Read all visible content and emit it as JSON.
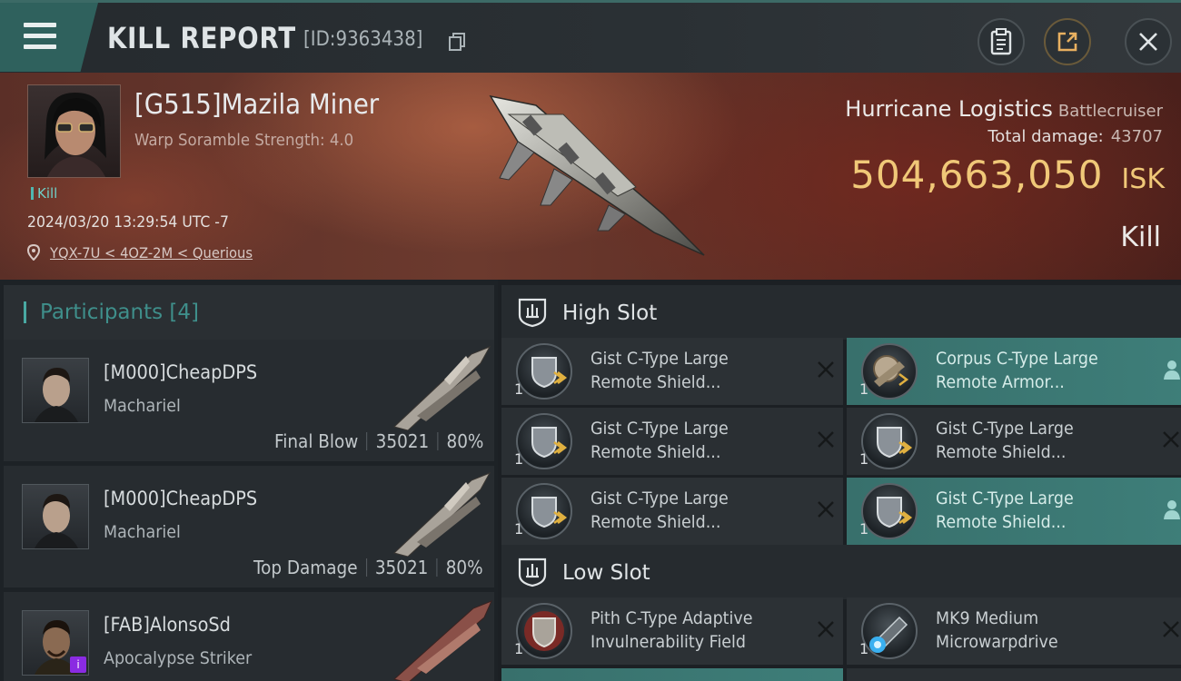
{
  "title": {
    "heading": "KILL REPORT",
    "id_text": "[ID:9363438]"
  },
  "victim": {
    "name": "[G515]Mazila Miner",
    "subtitle": "Warp Soramble Strength: 4.0",
    "tag": "Kill",
    "datetime": "2024/03/20 13:29:54 UTC -7",
    "location": "YQX-7U < 4OZ-2M < Querious",
    "ship_name": "Hurricane Logistics",
    "ship_class": "Battlecruiser",
    "total_damage_label": "Total damage:",
    "total_damage_value": "43707",
    "isk_value": "504,663,050",
    "isk_unit": "ISK",
    "result_label": "Kill"
  },
  "participants": {
    "header": "Participants [4]",
    "rows": [
      {
        "name": "[M000]CheapDPS",
        "ship": "Machariel",
        "role": "Final Blow",
        "damage": "35021",
        "percent": "80%"
      },
      {
        "name": "[M000]CheapDPS",
        "ship": "Machariel",
        "role": "Top Damage",
        "damage": "35021",
        "percent": "80%"
      },
      {
        "name": "[FAB]AlonsoSd",
        "ship": "Apocalypse Striker",
        "badge": "i"
      }
    ]
  },
  "fitting": {
    "high_slot_label": "High Slot",
    "low_slot_label": "Low Slot",
    "high_modules": [
      {
        "line1": "Gist C-Type Large",
        "line2": "Remote Shield...",
        "qty": "1"
      },
      {
        "line1": "Corpus C-Type Large",
        "line2": "Remote Armor...",
        "qty": "1"
      },
      {
        "line1": "Gist C-Type Large",
        "line2": "Remote Shield...",
        "qty": "1"
      },
      {
        "line1": "Gist C-Type Large",
        "line2": "Remote Shield...",
        "qty": "1"
      },
      {
        "line1": "Gist C-Type Large",
        "line2": "Remote Shield...",
        "qty": "1"
      },
      {
        "line1": "Gist C-Type Large",
        "line2": "Remote Shield...",
        "qty": "1"
      }
    ],
    "low_modules": [
      {
        "line1": "Pith C-Type Adaptive",
        "line2": "Invulnerability Field",
        "qty": "1"
      },
      {
        "line1": "MK9 Medium",
        "line2": "Microwarpdrive",
        "qty": "1"
      }
    ]
  },
  "colors": {
    "accent_teal": "#3f8f8b",
    "isk_gold": "#f0c878",
    "highlight_row": "#3e7e79"
  },
  "icons": {
    "menu": "hamburger-menu-icon",
    "copy": "copy-icon",
    "clipboard": "clipboard-icon",
    "share": "share-icon",
    "close": "close-icon",
    "location": "location-pin-icon",
    "slot": "slot-shield-icon",
    "remove": "remove-x-icon",
    "person": "person-icon"
  }
}
